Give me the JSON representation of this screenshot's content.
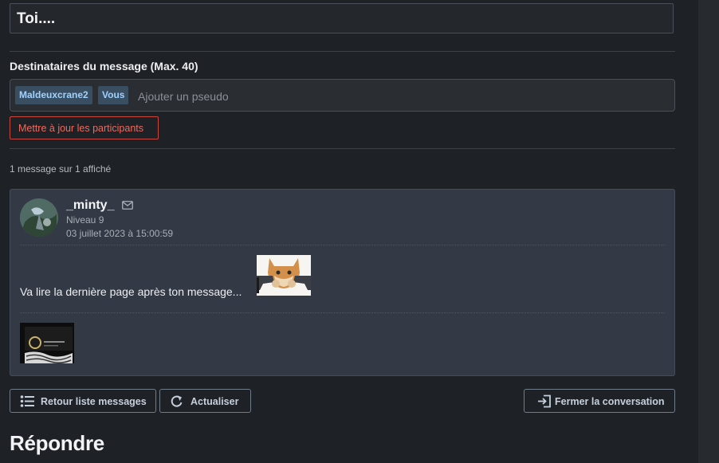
{
  "subject": "Toi....",
  "recipients": {
    "label": "Destinataires du message (Max. 40)",
    "tags": [
      "Maldeuxcrane2",
      "Vous"
    ],
    "input_placeholder": "Ajouter un pseudo",
    "update_button": "Mettre à jour les participants"
  },
  "message_count": "1 message sur 1 affiché",
  "message": {
    "author": "_minty_",
    "level": "Niveau 9",
    "date": "03 juillet 2023 à 15:00:59",
    "text": "Va lire la dernière page après ton message..."
  },
  "actions": {
    "back": "Retour liste messages",
    "refresh": "Actualiser",
    "close": "Fermer la conversation"
  },
  "reply_title": "Répondre",
  "icons": {
    "mail": "envelope-icon",
    "back": "list-icon",
    "refresh": "refresh-icon",
    "close": "exit-door-icon"
  },
  "colors": {
    "background": "#1e2126",
    "card": "#333a46",
    "tag_bg": "#3a4e62",
    "tag_text": "#9fd2ff",
    "danger": "#f06a5c"
  }
}
